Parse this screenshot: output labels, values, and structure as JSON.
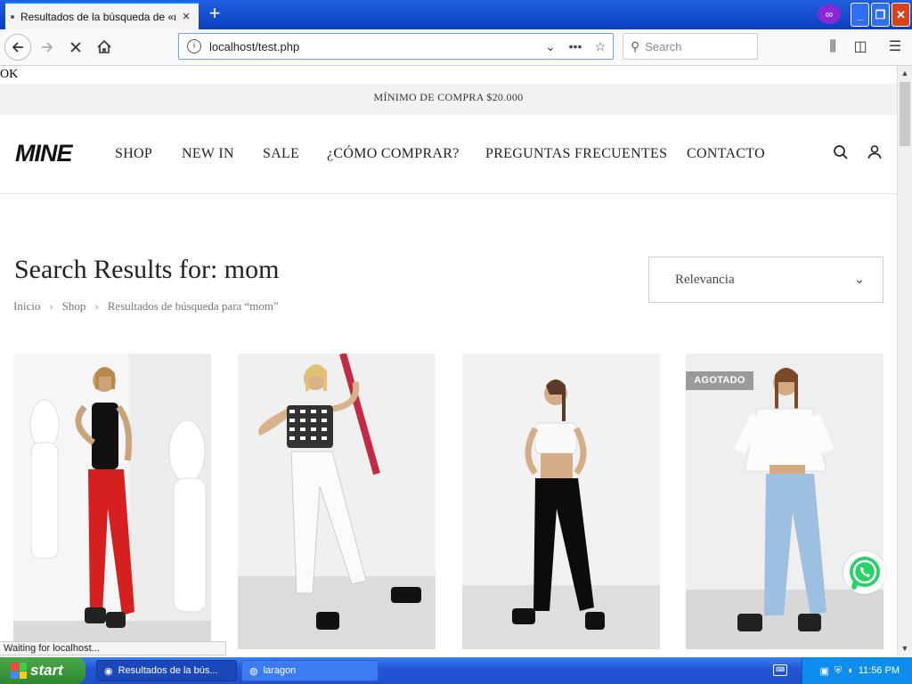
{
  "browser": {
    "tab_title": "Resultados de la búsqueda de «mom»",
    "tab_close": "×",
    "new_tab": "+",
    "url": "localhost/test.php",
    "search_placeholder": "Search",
    "status": "Waiting for localhost..."
  },
  "page": {
    "ok_text": "OK",
    "promo": "MÍNIMO DE COMPRA $20.000",
    "logo": "MINE",
    "nav": [
      "SHOP",
      "NEW IN",
      "SALE",
      "¿CÓMO COMPRAR?",
      "PREGUNTAS FRECUENTES",
      "CONTACTO"
    ],
    "title": "Search Results for: mom",
    "breadcrumb": [
      "Inicio",
      "Shop",
      "Resultados de búsqueda para “mom”"
    ],
    "sort_label": "Relevancia",
    "products": [
      {
        "badge": "",
        "color": "red jeans"
      },
      {
        "badge": "",
        "color": "white jeans"
      },
      {
        "badge": "",
        "color": "black jeans"
      },
      {
        "badge": "AGOTADO",
        "color": "light blue jeans"
      }
    ]
  },
  "taskbar": {
    "start": "start",
    "task1": "Resultados de la bús...",
    "task2": "laragon",
    "clock": "11:56 PM"
  },
  "colors": {
    "accent": "#0a84ff",
    "taskbar": "#2457d6",
    "start_green": "#3a9a3a",
    "whatsapp": "#25d366"
  }
}
